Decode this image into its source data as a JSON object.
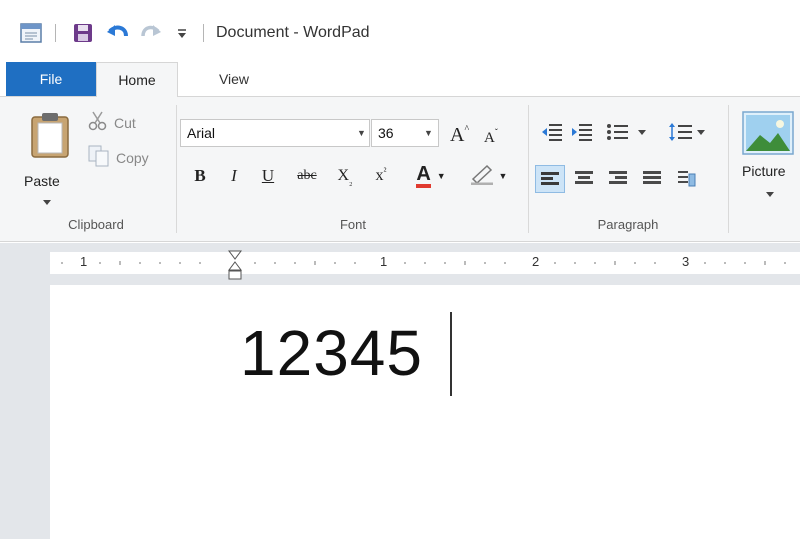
{
  "window": {
    "title": "Document - WordPad"
  },
  "quick_access": {
    "icons": [
      "app-icon",
      "save-icon",
      "undo-icon",
      "redo-icon",
      "customize-icon"
    ]
  },
  "tabs": {
    "file": "File",
    "home": "Home",
    "view": "View"
  },
  "clipboard": {
    "paste_label": "Paste",
    "cut_label": "Cut",
    "copy_label": "Copy",
    "group_label": "Clipboard"
  },
  "font": {
    "name": "Arial",
    "size": "36",
    "group_label": "Font",
    "grow_label": "A",
    "shrink_label": "A",
    "bold": "B",
    "italic": "I",
    "underline": "U",
    "strikethrough": "abc",
    "subscript": "X",
    "superscript": "x",
    "color_label": "A"
  },
  "paragraph": {
    "group_label": "Paragraph"
  },
  "insert": {
    "picture_label": "Picture"
  },
  "ruler": {
    "numbers": [
      "1",
      "1",
      "2",
      "3"
    ]
  },
  "document": {
    "content": "12345"
  },
  "colors": {
    "file_tab": "#1f6fc2",
    "ribbon_bg": "#f5f6f7",
    "workspace_bg": "#e3e6ea",
    "save_icon": "#6d3a8a",
    "undo_icon": "#2b79d6",
    "font_color_underline": "#e03a2f"
  }
}
